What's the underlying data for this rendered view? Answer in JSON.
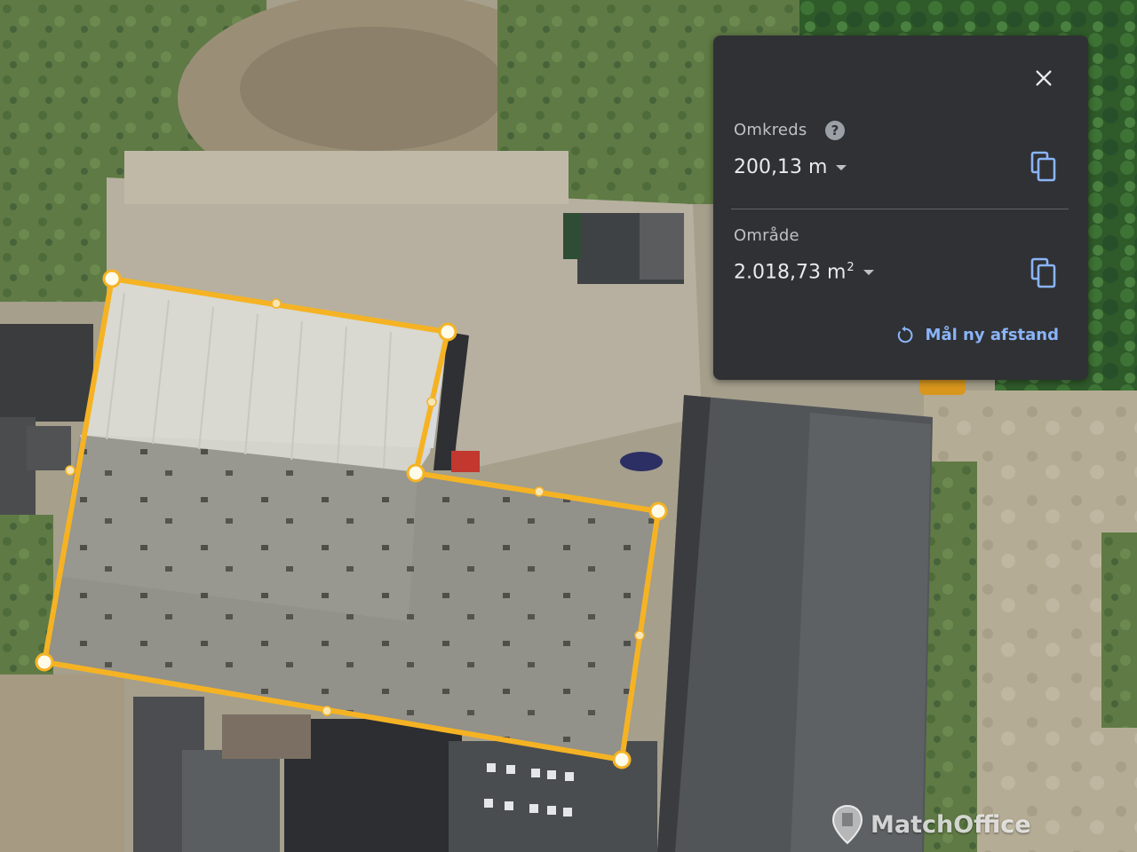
{
  "map": {
    "type": "satellite",
    "polygon_color": "#f5b324"
  },
  "panel": {
    "close_icon": "close-icon",
    "perimeter": {
      "label": "Omkreds",
      "help_icon": "help-icon",
      "help_glyph": "?",
      "value": "200,13 m",
      "copy_icon": "copy-icon"
    },
    "area": {
      "label": "Område",
      "value": "2.018,73 m",
      "unit_superscript": "2",
      "copy_icon": "copy-icon"
    },
    "new_measure": {
      "icon": "restart-icon",
      "label": "Mål ny afstand"
    },
    "colors": {
      "background": "#303134",
      "text": "#e8eaed",
      "muted": "#bdc1c6",
      "link": "#8ab4f8"
    }
  },
  "watermark": {
    "icon": "matchoffice-pin-icon",
    "text": "MatchOffice"
  }
}
